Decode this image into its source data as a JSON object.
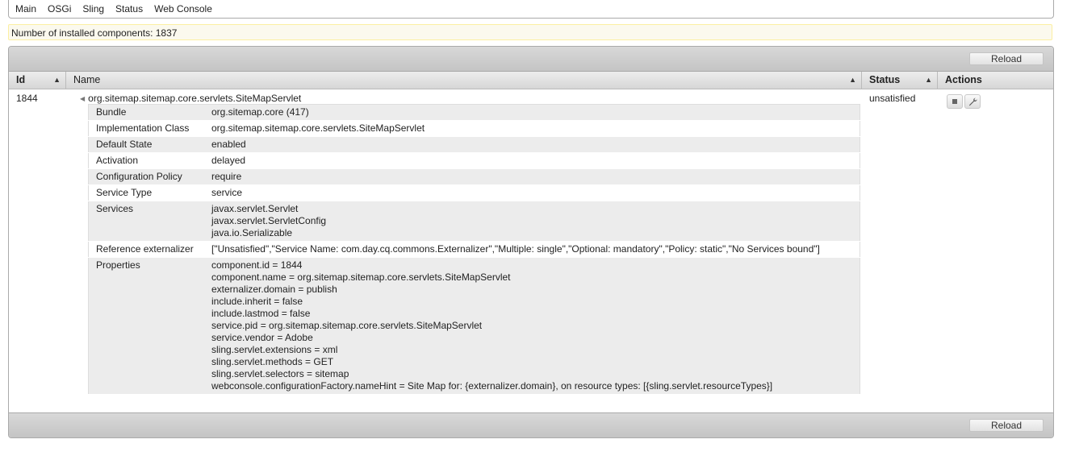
{
  "menu": [
    "Main",
    "OSGi",
    "Sling",
    "Status",
    "Web Console"
  ],
  "status_line": "Number of installed components: 1837",
  "toolbar": {
    "reload_label": "Reload"
  },
  "columns": {
    "id": "Id",
    "name": "Name",
    "status": "Status",
    "actions": "Actions"
  },
  "component": {
    "id": "1844",
    "name": "org.sitemap.sitemap.core.servlets.SiteMapServlet",
    "status": "unsatisfied"
  },
  "details": [
    {
      "key": "Bundle",
      "lines": [
        "org.sitemap.core (417)"
      ]
    },
    {
      "key": "Implementation Class",
      "lines": [
        "org.sitemap.sitemap.core.servlets.SiteMapServlet"
      ]
    },
    {
      "key": "Default State",
      "lines": [
        "enabled"
      ]
    },
    {
      "key": "Activation",
      "lines": [
        "delayed"
      ]
    },
    {
      "key": "Configuration Policy",
      "lines": [
        "require"
      ]
    },
    {
      "key": "Service Type",
      "lines": [
        "service"
      ]
    },
    {
      "key": "Services",
      "lines": [
        "javax.servlet.Servlet",
        "javax.servlet.ServletConfig",
        "java.io.Serializable"
      ]
    },
    {
      "key": "Reference externalizer",
      "lines": [
        "[\"Unsatisfied\",\"Service Name: com.day.cq.commons.Externalizer\",\"Multiple: single\",\"Optional: mandatory\",\"Policy: static\",\"No Services bound\"]"
      ]
    },
    {
      "key": "Properties",
      "lines": [
        "component.id = 1844",
        "component.name = org.sitemap.sitemap.core.servlets.SiteMapServlet",
        "externalizer.domain = publish",
        "include.inherit = false",
        "include.lastmod = false",
        "service.pid = org.sitemap.sitemap.core.servlets.SiteMapServlet",
        "service.vendor = Adobe",
        "sling.servlet.extensions = xml",
        "sling.servlet.methods = GET",
        "sling.servlet.selectors = sitemap",
        "webconsole.configurationFactory.nameHint = Site Map for: {externalizer.domain}, on resource types: [{sling.servlet.resourceTypes}]"
      ]
    }
  ]
}
